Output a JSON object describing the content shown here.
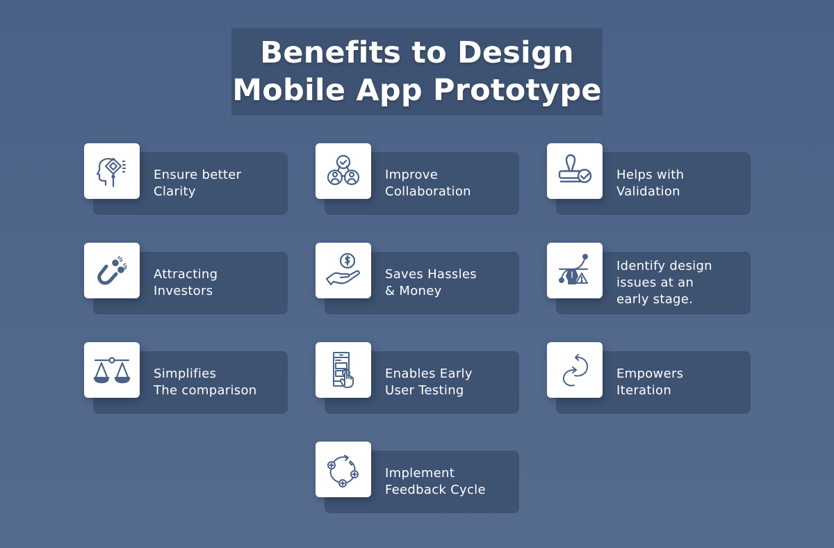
{
  "title": {
    "line1": "Benefits to Design",
    "line2": "Mobile App Prototype"
  },
  "colors": {
    "background_top": "#4a6288",
    "background_bottom": "#566c8e",
    "card": "#3e5272",
    "title_box": "#3e5373",
    "icon_bg": "#ffffff",
    "icon_stroke": "#4a6288",
    "text": "#ffffff"
  },
  "benefits": [
    {
      "icon": "head-clarity-icon",
      "lines": [
        "Ensure better",
        "Clarity"
      ]
    },
    {
      "icon": "collaboration-icon",
      "lines": [
        "Improve",
        "Collaboration"
      ]
    },
    {
      "icon": "stamp-validation-icon",
      "lines": [
        "Helps with",
        "Validation"
      ]
    },
    {
      "icon": "magnet-coins-icon",
      "lines": [
        "Attracting",
        "Investors"
      ]
    },
    {
      "icon": "hand-money-icon",
      "lines": [
        "Saves Hassles",
        "& Money"
      ]
    },
    {
      "icon": "pen-tool-warning-icon",
      "lines": [
        "Identify design",
        "issues at an",
        "early stage."
      ]
    },
    {
      "icon": "balance-scale-icon",
      "lines": [
        "Simplifies",
        "The comparison"
      ]
    },
    {
      "icon": "mobile-touch-icon",
      "lines": [
        "Enables Early",
        "User Testing"
      ]
    },
    {
      "icon": "iteration-arrows-icon",
      "lines": [
        "Empowers",
        "Iteration"
      ]
    },
    {
      "icon": "feedback-cycle-icon",
      "lines": [
        "Implement",
        "Feedback Cycle"
      ]
    }
  ]
}
